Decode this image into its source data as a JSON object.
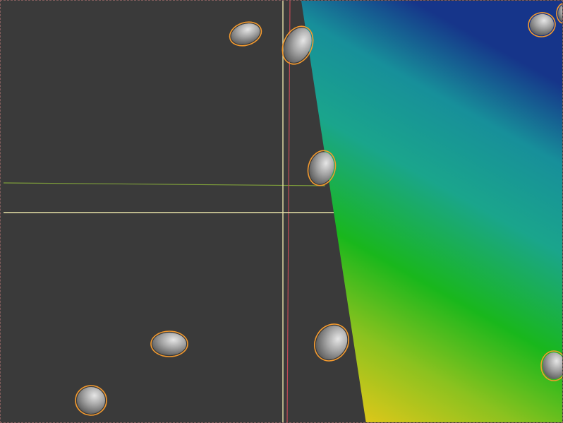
{
  "viewport": {
    "background_color": "#3a3a3a",
    "frame_color": "#b07878",
    "view_name": ""
  },
  "colors": {
    "selection_outline": "#f39a2f",
    "axis_x": "#7fa03a",
    "axis_y": "#c24a55",
    "cursor_crosshair": "#e8e2a8",
    "surface_gradient": [
      "#d6c21a",
      "#8cc21f",
      "#19b71c",
      "#1aa58c",
      "#178f9a",
      "#16358a"
    ],
    "particle_fill": "#8a8a8a"
  },
  "objects": {
    "particles": [
      {
        "name": "particle-1",
        "selected": true
      },
      {
        "name": "particle-2",
        "selected": true
      },
      {
        "name": "particle-3",
        "selected": true
      },
      {
        "name": "particle-4",
        "selected": true
      },
      {
        "name": "particle-5",
        "selected": true
      },
      {
        "name": "particle-6",
        "selected": true
      },
      {
        "name": "particle-7",
        "selected": true
      },
      {
        "name": "particle-8",
        "selected": true
      },
      {
        "name": "particle-9",
        "selected": true
      }
    ],
    "surface": {
      "name": "height-gradient-plane",
      "colormap": "viridis-like"
    }
  }
}
